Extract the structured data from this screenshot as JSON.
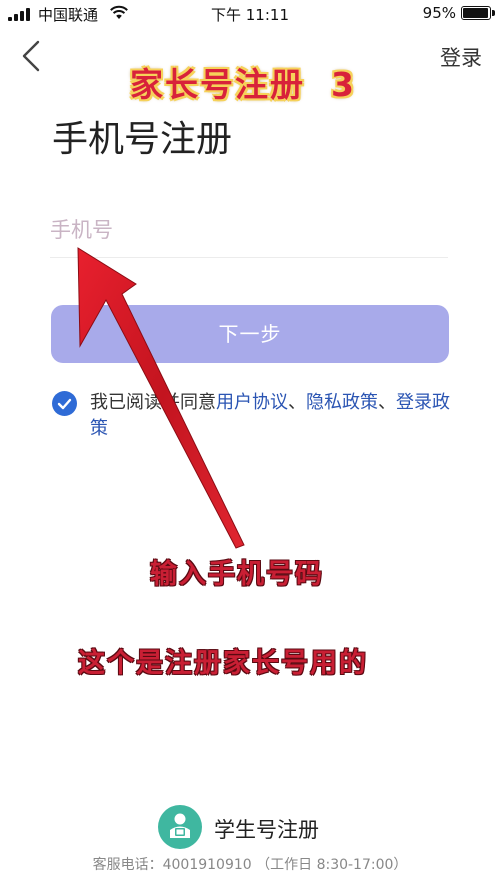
{
  "status_bar": {
    "carrier": "中国联通",
    "time": "下午 11:11",
    "battery": "95%",
    "battery_level": 0.95
  },
  "nav": {
    "back_icon": "chevron-left-icon",
    "login_label": "登录"
  },
  "overlay": {
    "title": "家长号注册",
    "title_num": "3",
    "input_hint": "输入手机号码",
    "note": "这个是注册家长号用的"
  },
  "page_title": "手机号注册",
  "phone_input": {
    "placeholder": "手机号",
    "value": ""
  },
  "next_button": "下一步",
  "agreement": {
    "checked": true,
    "prefix": "我已阅读并同意",
    "user_agreement": "用户协议",
    "sep1": "、",
    "privacy_policy": "隐私政策",
    "sep2": "、",
    "login_policy": "登录政策"
  },
  "student_register": {
    "icon": "student-icon",
    "label": "学生号注册"
  },
  "service_line": "客服电话：4001910910 （工作日 8:30-17:00）",
  "colors": {
    "button_bg": "#a8aaea",
    "check_blue": "#2f6bd6",
    "link_blue": "#2b55b3",
    "overlay_red": "#d8223a",
    "student_green": "#3fb7a0"
  }
}
